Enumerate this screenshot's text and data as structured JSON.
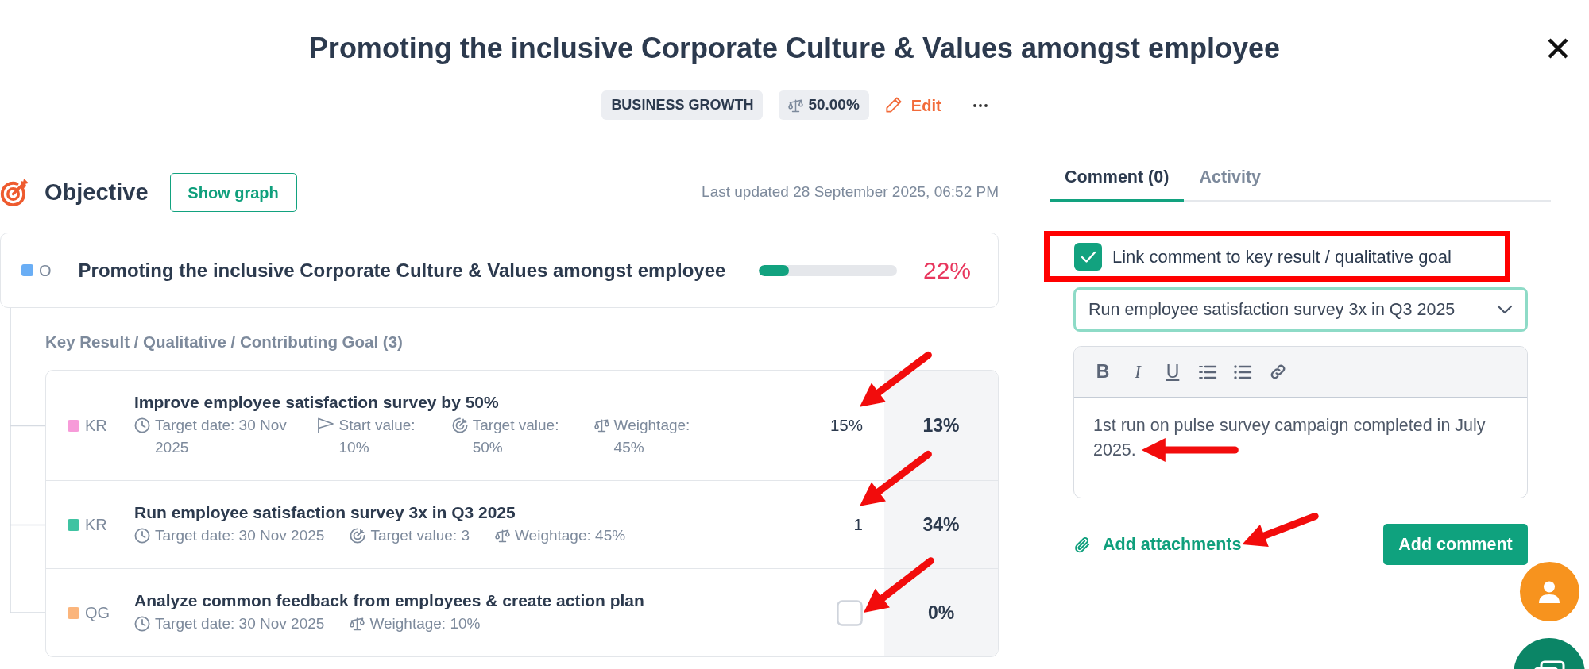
{
  "header": {
    "title": "Promoting the inclusive Corporate Culture & Values amongst employee",
    "tag": "BUSINESS GROWTH",
    "weightage": "50.00%",
    "edit": "Edit"
  },
  "objective_panel": {
    "heading": "Objective",
    "graph_button": "Show graph",
    "last_updated": "Last updated 28 September 2025, 06:52 PM",
    "objective": {
      "type_label": "O",
      "color": "#6aaef5",
      "title": "Promoting the inclusive Corporate Culture & Values amongst employee",
      "level": 0.22,
      "progress": "22%"
    },
    "children_heading": "Key Result / Qualitative / Contributing Goal (3)",
    "children": [
      {
        "kind": "value",
        "type_label": "KR",
        "color": "#f79bd9",
        "title": "Improve employee satisfaction survey by 50%",
        "meta": [
          {
            "kind": "date",
            "text": "Target date: 30 Nov 2025"
          },
          {
            "kind": "start",
            "text": "Start value: 10%"
          },
          {
            "kind": "target",
            "text": "Target value: 50%"
          },
          {
            "kind": "weight",
            "text": "Weightage: 45%"
          }
        ],
        "current": "15%",
        "progress": "13%",
        "annotated": true
      },
      {
        "kind": "value",
        "type_label": "KR",
        "color": "#3fc3a2",
        "title": "Run employee satisfaction survey 3x in Q3 2025",
        "meta": [
          {
            "kind": "date",
            "text": "Target date: 30 Nov 2025"
          },
          {
            "kind": "target",
            "text": "Target value: 3"
          },
          {
            "kind": "weight",
            "text": "Weightage: 45%"
          }
        ],
        "current": "1",
        "progress": "34%",
        "annotated": true
      },
      {
        "kind": "check",
        "type_label": "QG",
        "color": "#fbb57c",
        "title": "Analyze common feedback from employees & create action plan",
        "meta": [
          {
            "kind": "date",
            "text": "Target date: 30 Nov 2025"
          },
          {
            "kind": "weight",
            "text": "Weightage: 10%"
          }
        ],
        "done": false,
        "progress": "0%",
        "annotated": true
      }
    ]
  },
  "comment_panel": {
    "tabs": [
      {
        "label": "Comment (0)",
        "selected": true
      },
      {
        "label": "Activity",
        "selected": false
      }
    ],
    "link_to_goal": {
      "label": "Link comment to key result / qualitative goal",
      "checked": true,
      "highlighted": true
    },
    "goal_select": {
      "value": "Run employee satisfaction survey 3x in Q3 2025"
    },
    "toolbar": [
      {
        "kind": "bold",
        "label": "B"
      },
      {
        "kind": "italic",
        "label": "I"
      },
      {
        "kind": "underline",
        "label": "U"
      },
      {
        "kind": "ordered_list"
      },
      {
        "kind": "bullet_list"
      },
      {
        "kind": "link"
      }
    ],
    "comment": {
      "value": "1st run on pulse survey campaign completed in July 2025.",
      "annotated": true
    },
    "attachments": {
      "label": "Add attachments",
      "annotated": true
    },
    "submit": "Add comment"
  },
  "floating_buttons": [
    {
      "kind": "profile"
    },
    {
      "kind": "chat"
    }
  ]
}
